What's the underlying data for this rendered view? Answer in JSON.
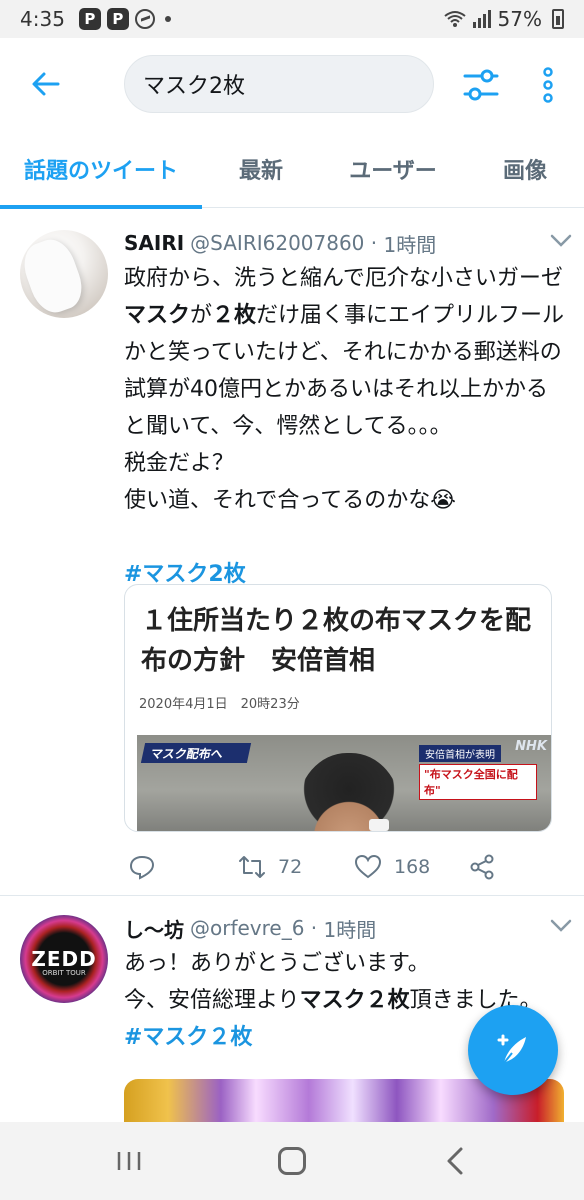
{
  "status_bar": {
    "time": "4:35",
    "app_icons": [
      "P",
      "P"
    ],
    "battery": "57%"
  },
  "header": {
    "search_value": "マスク2枚"
  },
  "tabs": [
    {
      "label": "話題のツイート",
      "active": true
    },
    {
      "label": "最新",
      "active": false
    },
    {
      "label": "ユーザー",
      "active": false
    },
    {
      "label": "画像",
      "active": false
    }
  ],
  "tweets": [
    {
      "display_name": "SAIRI",
      "handle": "@SAIRI62007860",
      "time": "1時間",
      "text_parts": {
        "p1": "政府から、洗うと縮んで厄介な小さいガーゼ",
        "b1": "マスク",
        "p2": "が",
        "b2": "２枚",
        "p3": "だけ届く事にエイプリルフールかと笑っていたけど、それにかかる郵送料の試算が40億円とかあるいはそれ以上かかると聞いて、今、愕然としてる。。。",
        "line2": "税金だよ？",
        "line3": "使い道、それで合ってるのかな😭"
      },
      "hashtag": "#マスク2枚",
      "card": {
        "title": "１住所当たり２枚の布マスクを配布の方針　安倍首相",
        "date": "2020年4月1日　20時23分",
        "banner_left": "マスク配布へ",
        "banner_right_top": "安倍首相が表明",
        "banner_right_bottom": "\"布マスク全国に配布\"",
        "logo": "NHK"
      },
      "retweets": "72",
      "likes": "168"
    },
    {
      "display_name": "し〜坊",
      "handle": "@orfevre_6",
      "time": "1時間",
      "avatar_text": "ZEDD",
      "avatar_subtext": "ORBIT TOUR",
      "text_parts": {
        "line1": "あっ！ありがとうございます。",
        "p1": "今、安倍総理より",
        "b1": "マスク２枚",
        "p2": "頂きました。"
      },
      "hashtag": "#マスク２枚"
    }
  ],
  "colors": {
    "accent": "#1da1f2",
    "hashtag": "#1b95e0"
  },
  "icons": {
    "back": "arrow-left-icon",
    "filter": "sliders-icon",
    "more": "more-vertical-icon",
    "reply": "reply-icon",
    "retweet": "retweet-icon",
    "like": "heart-icon",
    "share": "share-icon",
    "compose": "compose-icon"
  }
}
